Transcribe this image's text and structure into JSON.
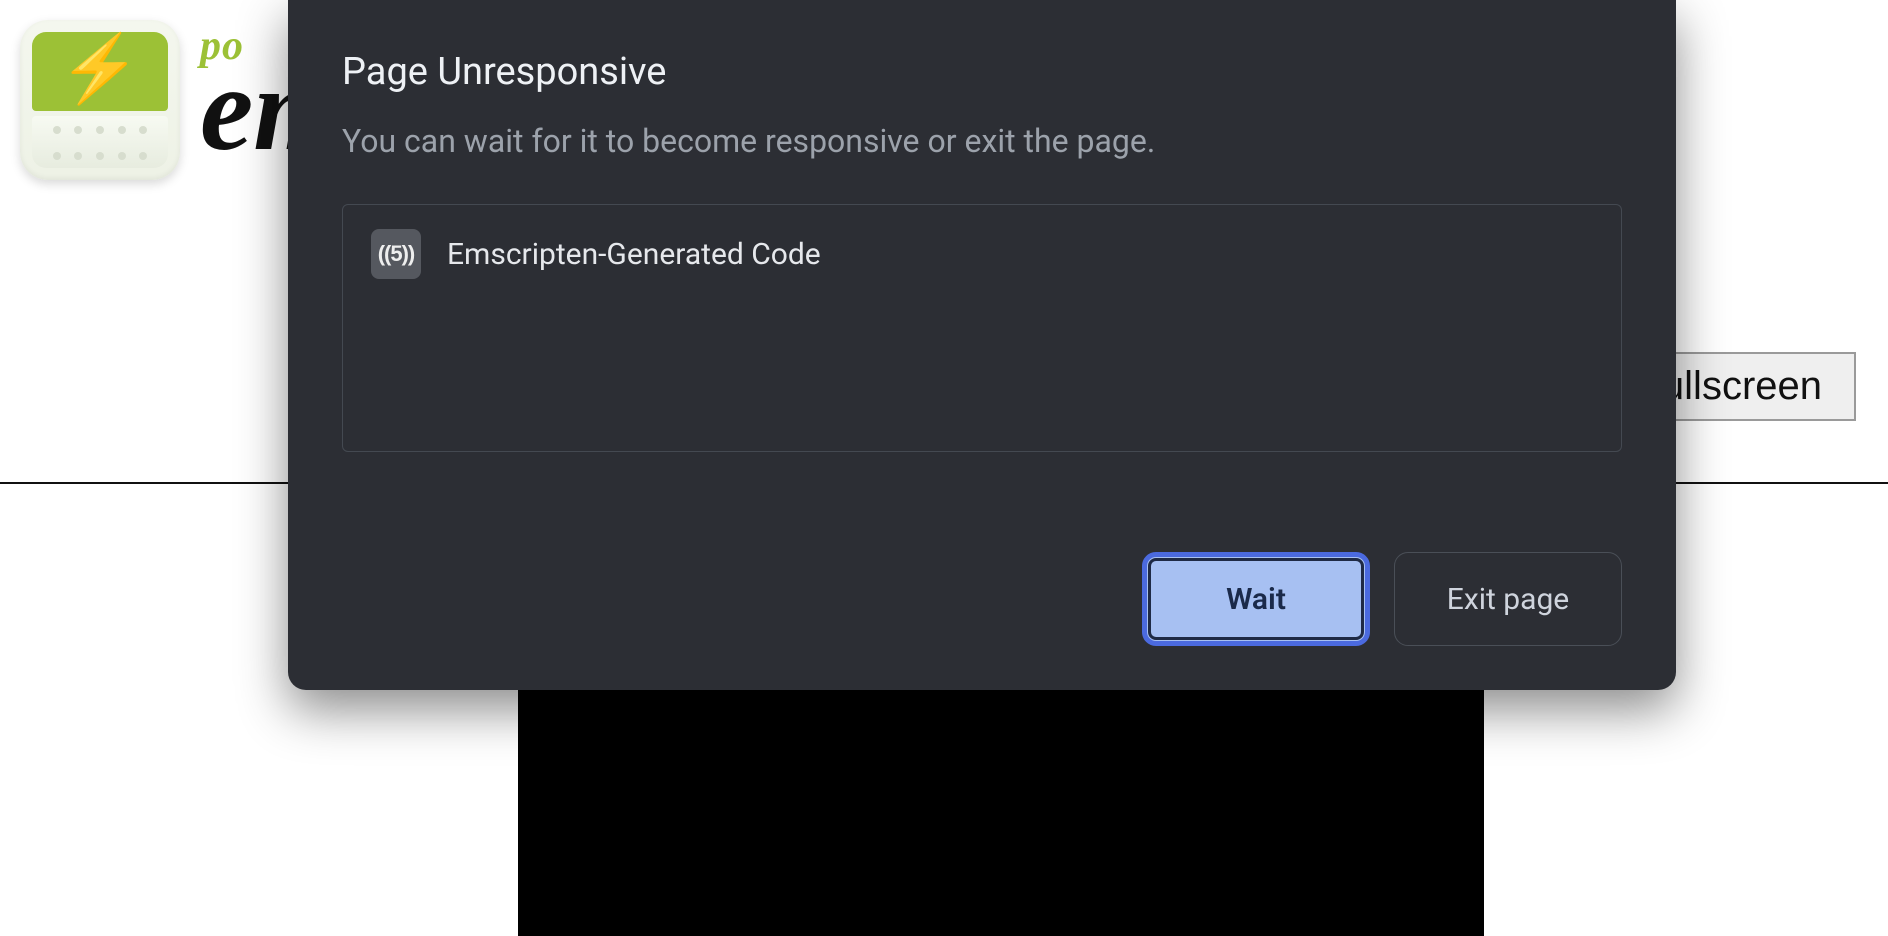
{
  "page": {
    "logo_tag_top": "po",
    "logo_tag_main": "em",
    "fullscreen_label": "Fullscreen"
  },
  "dialog": {
    "title": "Page Unresponsive",
    "subtitle": "You can wait for it to become responsive or exit the page.",
    "item_icon_text": "((5))",
    "item_label": "Emscripten-Generated Code",
    "wait_label": "Wait",
    "exit_label": "Exit page"
  }
}
